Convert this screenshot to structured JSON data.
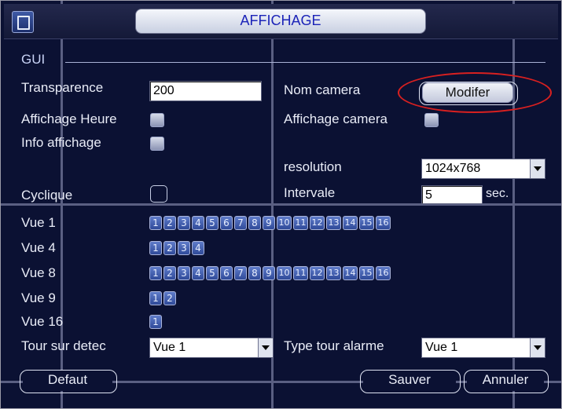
{
  "window": {
    "title": "AFFICHAGE"
  },
  "section": {
    "title": "GUI"
  },
  "labels": {
    "transparence": "Transparence",
    "affichage_heure": "Affichage Heure",
    "info_affichage": "Info affichage",
    "cyclique": "Cyclique",
    "nom_camera": "Nom camera",
    "affichage_camera": "Affichage camera",
    "resolution": "resolution",
    "intervale": "Intervale",
    "sec": "sec.",
    "vue1": "Vue 1",
    "vue4": "Vue 4",
    "vue8": "Vue 8",
    "vue9": "Vue 9",
    "vue16": "Vue 16",
    "tour_sur_detec": "Tour sur detec",
    "type_tour_alarme": "Type tour alarme"
  },
  "fields": {
    "transparence_value": "200",
    "intervale_value": "5",
    "resolution_selected": "1024x768",
    "tour_sur_detec_selected": "Vue 1",
    "type_tour_alarme_selected": "Vue 1"
  },
  "checkboxes": {
    "affichage_heure": "checked-appearance",
    "affichage_camera": "checked-appearance",
    "info_affichage": "checked-appearance",
    "cyclique": "unchecked"
  },
  "channels": {
    "vue1": [
      "1",
      "2",
      "3",
      "4",
      "5",
      "6",
      "7",
      "8",
      "9",
      "10",
      "11",
      "12",
      "13",
      "14",
      "15",
      "16"
    ],
    "vue4": [
      "1",
      "2",
      "3",
      "4"
    ],
    "vue8": [
      "1",
      "2",
      "3",
      "4",
      "5",
      "6",
      "7",
      "8",
      "9",
      "10",
      "11",
      "12",
      "13",
      "14",
      "15",
      "16"
    ],
    "vue9": [
      "1",
      "2"
    ],
    "vue16": [
      "1"
    ]
  },
  "buttons": {
    "modifier": "Modifer",
    "defaut": "Defaut",
    "sauver": "Sauver",
    "annuler": "Annuler"
  },
  "colors": {
    "background": "#0b1133",
    "title_text": "#1c24b8",
    "highlight_ellipse": "#d82020",
    "channel_button": "#3f5cae"
  }
}
